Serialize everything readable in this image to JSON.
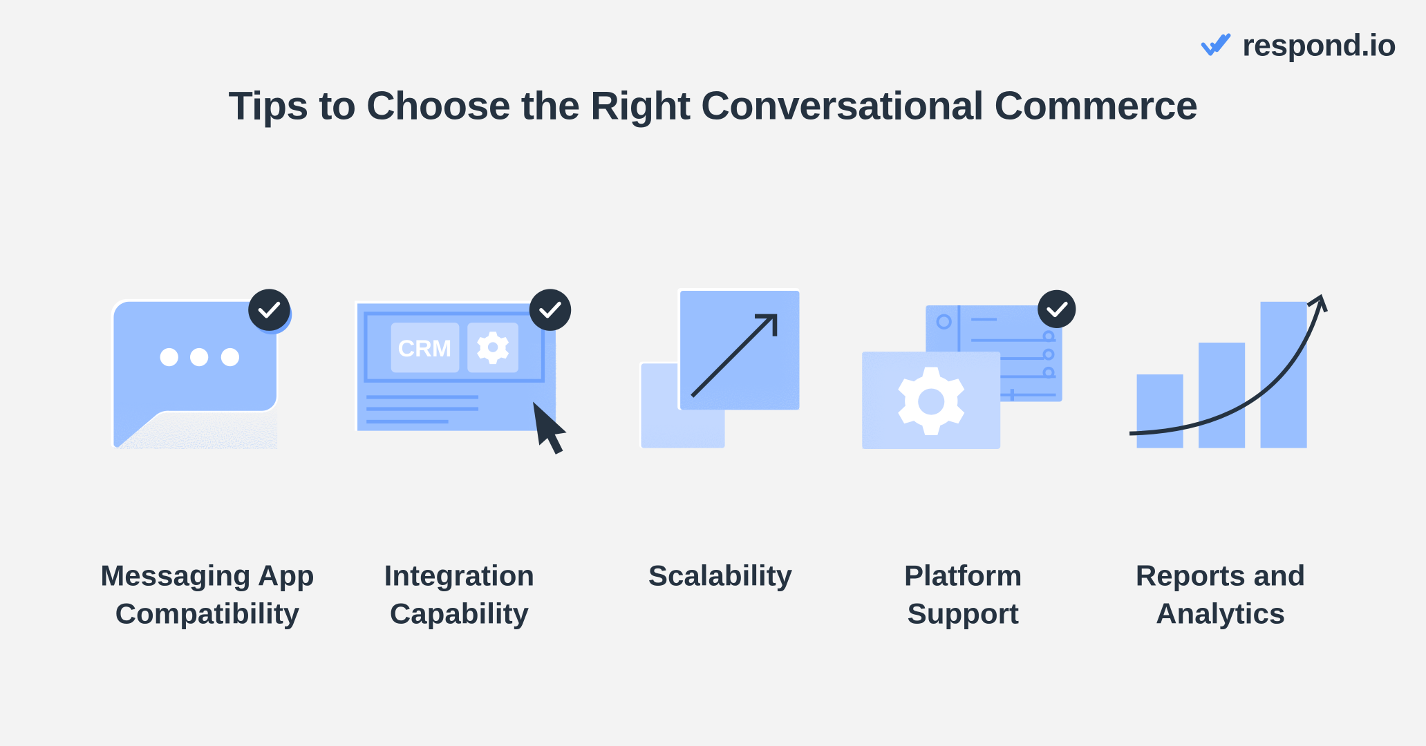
{
  "brand": {
    "logo_text": "respond.io",
    "logo_icon": "double-check-icon"
  },
  "title": "Tips to Choose the Right Conversational Commerce",
  "colors": {
    "background": "#f3f3f3",
    "text": "#253240",
    "blue_primary": "#99bfff",
    "blue_light": "#c3d8ff",
    "blue_dark": "#6fa2fc",
    "check_badge": "#253240",
    "logo_blue": "#4d8ff7"
  },
  "tips": [
    {
      "icon": "chat-bubble-icon",
      "lines": [
        "Messaging App",
        "Compatibility"
      ],
      "checked": true
    },
    {
      "icon": "crm-integration-icon",
      "lines": [
        "Integration",
        "Capability"
      ],
      "checked": true,
      "badge_text": "CRM"
    },
    {
      "icon": "scale-up-icon",
      "lines": [
        "Scalability"
      ],
      "checked": false
    },
    {
      "icon": "platform-settings-icon",
      "lines": [
        "Platform",
        "Support"
      ],
      "checked": true
    },
    {
      "icon": "growth-chart-icon",
      "lines": [
        "Reports and",
        "Analytics"
      ],
      "checked": false
    }
  ]
}
